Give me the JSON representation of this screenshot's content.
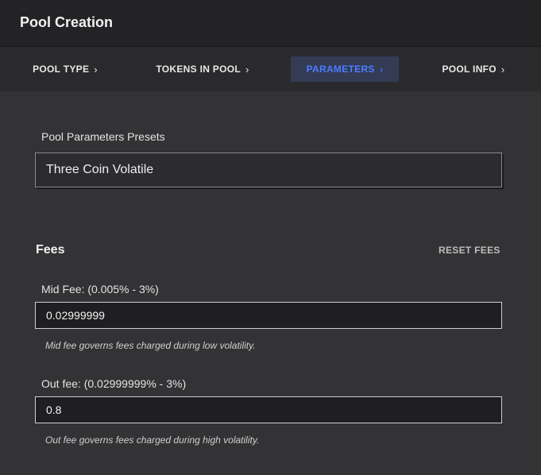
{
  "header": {
    "title": "Pool Creation"
  },
  "tabs": [
    {
      "label": "POOL TYPE",
      "chevron": "›"
    },
    {
      "label": "TOKENS IN POOL",
      "chevron": "›"
    },
    {
      "label": "PARAMETERS",
      "chevron": "›"
    },
    {
      "label": "POOL INFO",
      "chevron": "›"
    }
  ],
  "presets": {
    "label": "Pool Parameters Presets",
    "selected": "Three Coin Volatile"
  },
  "fees": {
    "title": "Fees",
    "reset_label": "RESET FEES",
    "mid_fee": {
      "label": "Mid Fee: (0.005% - 3%)",
      "value": "0.02999999",
      "hint": "Mid fee governs fees charged during low volatility."
    },
    "out_fee": {
      "label": "Out fee: (0.02999999% - 3%)",
      "value": "0.8",
      "hint": "Out fee governs fees charged during high volatility."
    }
  },
  "colors": {
    "active_tab_text": "#4a7dff",
    "active_tab_bg": "#343b55",
    "background": "#333335"
  }
}
